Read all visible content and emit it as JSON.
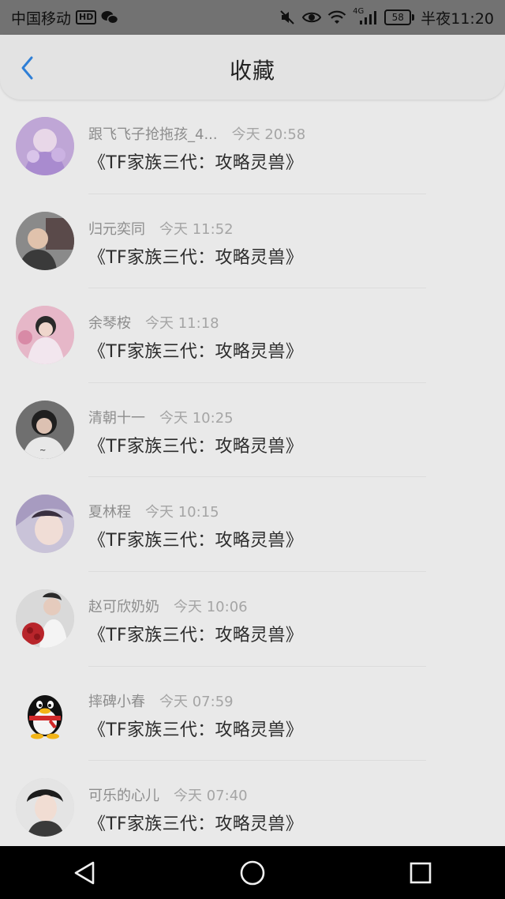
{
  "status_bar": {
    "carrier": "中国移动",
    "hd_badge": "HD",
    "network_tag": "4G",
    "battery": "58",
    "time": "半夜11:20"
  },
  "header": {
    "title": "收藏"
  },
  "favorites": [
    {
      "user": "跟飞飞子抢拖孩_4...",
      "time": "今天 20:58",
      "title": "《TF家族三代：攻略灵兽》",
      "avatar": "avatar-1"
    },
    {
      "user": "归元奕同",
      "time": "今天 11:52",
      "title": "《TF家族三代：攻略灵兽》",
      "avatar": "avatar-2"
    },
    {
      "user": "余琴桉",
      "time": "今天 11:18",
      "title": "《TF家族三代：攻略灵兽》",
      "avatar": "avatar-3"
    },
    {
      "user": "清朝十一",
      "time": "今天 10:25",
      "title": "《TF家族三代：攻略灵兽》",
      "avatar": "avatar-4"
    },
    {
      "user": "夏林程",
      "time": "今天 10:15",
      "title": "《TF家族三代：攻略灵兽》",
      "avatar": "avatar-5"
    },
    {
      "user": "赵可欣奶奶",
      "time": "今天 10:06",
      "title": "《TF家族三代：攻略灵兽》",
      "avatar": "avatar-6"
    },
    {
      "user": "摔碑小春",
      "time": "今天 07:59",
      "title": "《TF家族三代：攻略灵兽》",
      "avatar": "qq-penguin"
    },
    {
      "user": "可乐的心儿",
      "time": "今天 07:40",
      "title": "《TF家族三代：攻略灵兽》",
      "avatar": "avatar-8"
    }
  ],
  "colors": {
    "accent": "#2f7fd6",
    "overlay_bg": "#e9e9e9",
    "status_bar": "#727272",
    "nav_bar": "#000000"
  },
  "icons": {
    "back": "chevron-left-icon",
    "mute": "mute-icon",
    "eye": "eye-icon",
    "wifi": "wifi-icon",
    "signal": "signal-icon",
    "wechat": "wechat-icon",
    "nav_back": "triangle-back-icon",
    "nav_home": "circle-home-icon",
    "nav_recent": "square-recent-icon"
  }
}
